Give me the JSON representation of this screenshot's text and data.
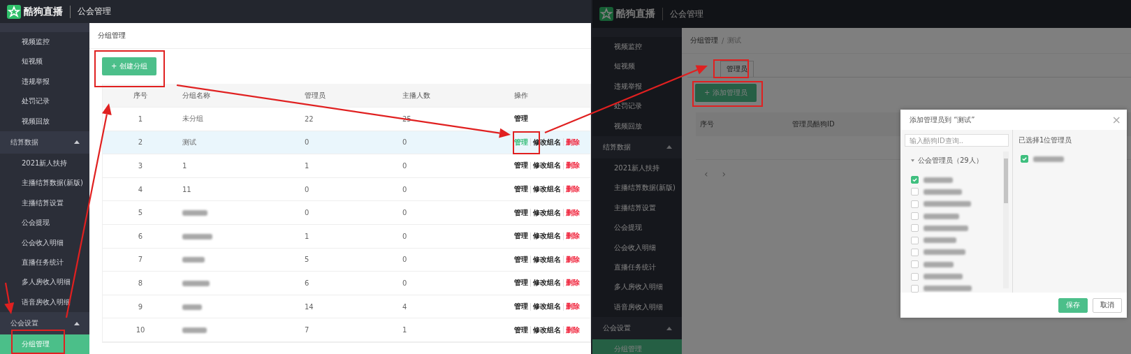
{
  "left_screen": {
    "header": {
      "brand": "酷狗直播",
      "title": "公会管理"
    },
    "sidebar": [
      {
        "kind": "item",
        "label": "视频监控",
        "selected": false
      },
      {
        "kind": "item",
        "label": "短视频",
        "selected": false
      },
      {
        "kind": "item",
        "label": "违规举报",
        "selected": false
      },
      {
        "kind": "item",
        "label": "处罚记录",
        "selected": false
      },
      {
        "kind": "item",
        "label": "视频回放",
        "selected": false
      },
      {
        "kind": "group",
        "label": "结算数据",
        "expanded": true
      },
      {
        "kind": "item",
        "label": "2021新人扶持",
        "selected": false
      },
      {
        "kind": "item",
        "label": "主播结算数据(新版)",
        "selected": false
      },
      {
        "kind": "item",
        "label": "主播结算设置",
        "selected": false
      },
      {
        "kind": "item",
        "label": "公会提现",
        "selected": false
      },
      {
        "kind": "item",
        "label": "公会收入明细",
        "selected": false
      },
      {
        "kind": "item",
        "label": "直播任务统计",
        "selected": false
      },
      {
        "kind": "item",
        "label": "多人房收入明细",
        "selected": false
      },
      {
        "kind": "item",
        "label": "语音房收入明细",
        "selected": false
      },
      {
        "kind": "group",
        "label": "公会设置",
        "expanded": true
      },
      {
        "kind": "item",
        "label": "分组管理",
        "selected": true
      }
    ],
    "breadcrumb": "分组管理",
    "create_button": "+ 创建分组",
    "table": {
      "columns": [
        "序号",
        "分组名称",
        "管理员",
        "主播人数",
        "操作"
      ],
      "rows": [
        {
          "index": "1",
          "name": "未分组",
          "admins": "22",
          "anchors": "25",
          "selected": false,
          "actions": [
            {
              "kind": "manage",
              "label": "管理"
            }
          ]
        },
        {
          "index": "2",
          "name": "测试",
          "admins": "0",
          "anchors": "0",
          "selected": true,
          "actions": [
            {
              "kind": "manage",
              "label": "管理"
            },
            {
              "kind": "rename",
              "label": "修改组名"
            },
            {
              "kind": "delete",
              "label": "删除"
            }
          ]
        },
        {
          "index": "3",
          "name": "1",
          "admins": "1",
          "anchors": "0",
          "selected": false,
          "actions": [
            {
              "kind": "manage",
              "label": "管理"
            },
            {
              "kind": "rename",
              "label": "修改组名"
            },
            {
              "kind": "delete",
              "label": "删除"
            }
          ]
        },
        {
          "index": "4",
          "name": "11",
          "admins": "0",
          "anchors": "0",
          "selected": false,
          "actions": [
            {
              "kind": "manage",
              "label": "管理"
            },
            {
              "kind": "rename",
              "label": "修改组名"
            },
            {
              "kind": "delete",
              "label": "删除"
            }
          ]
        },
        {
          "index": "5",
          "redacted": true,
          "admins": "0",
          "anchors": "0",
          "selected": false,
          "actions": [
            {
              "kind": "manage",
              "label": "管理"
            },
            {
              "kind": "rename",
              "label": "修改组名"
            },
            {
              "kind": "delete",
              "label": "删除"
            }
          ]
        },
        {
          "index": "6",
          "redacted": true,
          "admins": "1",
          "anchors": "0",
          "selected": false,
          "actions": [
            {
              "kind": "manage",
              "label": "管理"
            },
            {
              "kind": "rename",
              "label": "修改组名"
            },
            {
              "kind": "delete",
              "label": "删除"
            }
          ]
        },
        {
          "index": "7",
          "redacted": true,
          "admins": "5",
          "anchors": "0",
          "selected": false,
          "actions": [
            {
              "kind": "manage",
              "label": "管理"
            },
            {
              "kind": "rename",
              "label": "修改组名"
            },
            {
              "kind": "delete",
              "label": "删除"
            }
          ]
        },
        {
          "index": "8",
          "redacted": true,
          "admins": "6",
          "anchors": "0",
          "selected": false,
          "actions": [
            {
              "kind": "manage",
              "label": "管理"
            },
            {
              "kind": "rename",
              "label": "修改组名"
            },
            {
              "kind": "delete",
              "label": "删除"
            }
          ]
        },
        {
          "index": "9",
          "redacted": true,
          "admins": "14",
          "anchors": "4",
          "selected": false,
          "actions": [
            {
              "kind": "manage",
              "label": "管理"
            },
            {
              "kind": "rename",
              "label": "修改组名"
            },
            {
              "kind": "delete",
              "label": "删除"
            }
          ]
        },
        {
          "index": "10",
          "redacted": true,
          "admins": "7",
          "anchors": "1",
          "selected": false,
          "actions": [
            {
              "kind": "manage",
              "label": "管理"
            },
            {
              "kind": "rename",
              "label": "修改组名"
            },
            {
              "kind": "delete",
              "label": "删除"
            }
          ]
        }
      ]
    }
  },
  "right_screen": {
    "header": {
      "brand": "酷狗直播",
      "title": "公会管理"
    },
    "sidebar": [
      {
        "kind": "item",
        "label": "视频监控",
        "selected": false
      },
      {
        "kind": "item",
        "label": "短视频",
        "selected": false
      },
      {
        "kind": "item",
        "label": "违规举报",
        "selected": false
      },
      {
        "kind": "item",
        "label": "处罚记录",
        "selected": false
      },
      {
        "kind": "item",
        "label": "视频回放",
        "selected": false
      },
      {
        "kind": "group",
        "label": "结算数据",
        "expanded": true
      },
      {
        "kind": "item",
        "label": "2021新人扶持",
        "selected": false
      },
      {
        "kind": "item",
        "label": "主播结算数据(新版)",
        "selected": false
      },
      {
        "kind": "item",
        "label": "主播结算设置",
        "selected": false
      },
      {
        "kind": "item",
        "label": "公会提现",
        "selected": false
      },
      {
        "kind": "item",
        "label": "公会收入明细",
        "selected": false
      },
      {
        "kind": "item",
        "label": "直播任务统计",
        "selected": false
      },
      {
        "kind": "item",
        "label": "多人房收入明细",
        "selected": false
      },
      {
        "kind": "item",
        "label": "语音房收入明细",
        "selected": false
      },
      {
        "kind": "group",
        "label": "公会设置",
        "expanded": true
      },
      {
        "kind": "item",
        "label": "分组管理",
        "selected": true
      }
    ],
    "breadcrumb": {
      "items": [
        "分组管理",
        "测试"
      ],
      "separator": "/"
    },
    "tabs": [
      {
        "label": "管理员",
        "selected": true
      }
    ],
    "add_button": "+ 添加管理员",
    "table": {
      "columns": [
        "序号",
        "管理员酷狗ID"
      ]
    },
    "pagination": {
      "prev": "‹",
      "next": "›"
    },
    "dialog": {
      "title": "添加管理员到 “测试”",
      "close": "×",
      "search": {
        "placeholder": "输入酷狗ID查询.."
      },
      "group": {
        "label": "公会管理员（29人）",
        "expanded": true
      },
      "members": [
        {
          "checked": true
        },
        {
          "checked": false
        },
        {
          "checked": false
        },
        {
          "checked": false
        },
        {
          "checked": false
        },
        {
          "checked": false
        },
        {
          "checked": false
        },
        {
          "checked": false
        },
        {
          "checked": false
        },
        {
          "checked": false
        }
      ],
      "selected_heading": "已选择1位管理员",
      "selected_members": [
        {
          "checked": true
        }
      ],
      "buttons": [
        {
          "kind": "primary",
          "label": "保存"
        },
        {
          "kind": "default",
          "label": "取消"
        }
      ]
    }
  }
}
